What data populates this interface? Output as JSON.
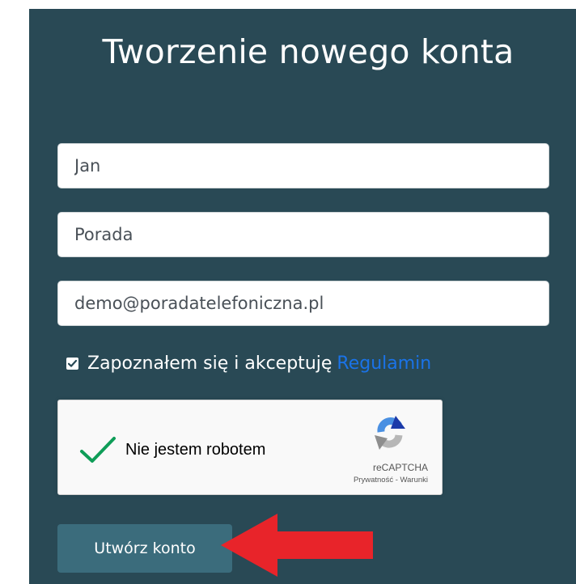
{
  "form": {
    "title": "Tworzenie nowego konta",
    "fields": [
      {
        "name": "first-name",
        "value": "Jan"
      },
      {
        "name": "last-name",
        "value": "Porada"
      },
      {
        "name": "email",
        "value": "demo@poradatelefoniczna.pl"
      }
    ],
    "consent": {
      "checked": true,
      "text": "Zapoznałem się i akceptuję",
      "link_label": "Regulamin"
    },
    "recaptcha": {
      "checked": true,
      "label": "Nie jestem robotem",
      "brand": "reCAPTCHA",
      "links": "Prywatność - Warunki"
    },
    "submit_label": "Utwórz konto"
  },
  "colors": {
    "panel_background": "#294955",
    "button_background": "#3b6c7c",
    "link": "#1a73e8",
    "recaptcha_check": "#0f9d58",
    "annotation_arrow": "#e8242a"
  },
  "icons": {
    "consent_checkbox": "checkbox-checked-icon",
    "recaptcha_check": "green-checkmark-icon",
    "recaptcha_logo": "recaptcha-logo-icon",
    "annotation": "red-arrow-icon"
  }
}
